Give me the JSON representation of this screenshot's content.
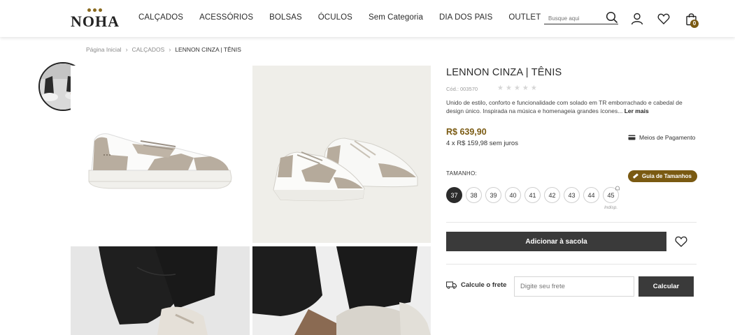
{
  "header": {
    "logo": "NOHA",
    "nav": [
      "CALÇADOS",
      "ACESSÓRIOS",
      "BOLSAS",
      "ÓCULOS",
      "Sem Categoria",
      "DIA DOS PAIS",
      "OUTLET"
    ],
    "search_placeholder": "Busque aqui",
    "cart_count": "0"
  },
  "breadcrumb": {
    "home": "Página Inicial",
    "category": "CALÇADOS",
    "current": "LENNON CINZA | TÊNIS"
  },
  "product": {
    "title": "LENNON CINZA | TÊNIS",
    "code": "Cód.: 003570",
    "rating": 0,
    "description": "Unido de estilo, conforto e funcionalidade com solado em TR emborrachado e cabedal de design único. Inspirada na música e homenageia grandes ícones...",
    "read_more": "Ler mais",
    "price": "R$ 639,90",
    "installments": "4 x R$ 159,98 sem juros",
    "payment_link": "Meios de Pagamento",
    "size_label": "TAMANHO:",
    "size_guide": "Guia de Tamanhos",
    "sizes": [
      "37",
      "38",
      "39",
      "40",
      "41",
      "42",
      "43",
      "44",
      "45"
    ],
    "selected_size": "37",
    "unavailable_note": "Indisp.",
    "add_to_bag": "Adicionar à sacola",
    "freight_label": "Calcule o frete",
    "freight_placeholder": "Digite seu frete",
    "calc_button": "Calcular"
  },
  "colors": {
    "accent": "#7a5a12",
    "dark_button": "#3a3a3a"
  }
}
